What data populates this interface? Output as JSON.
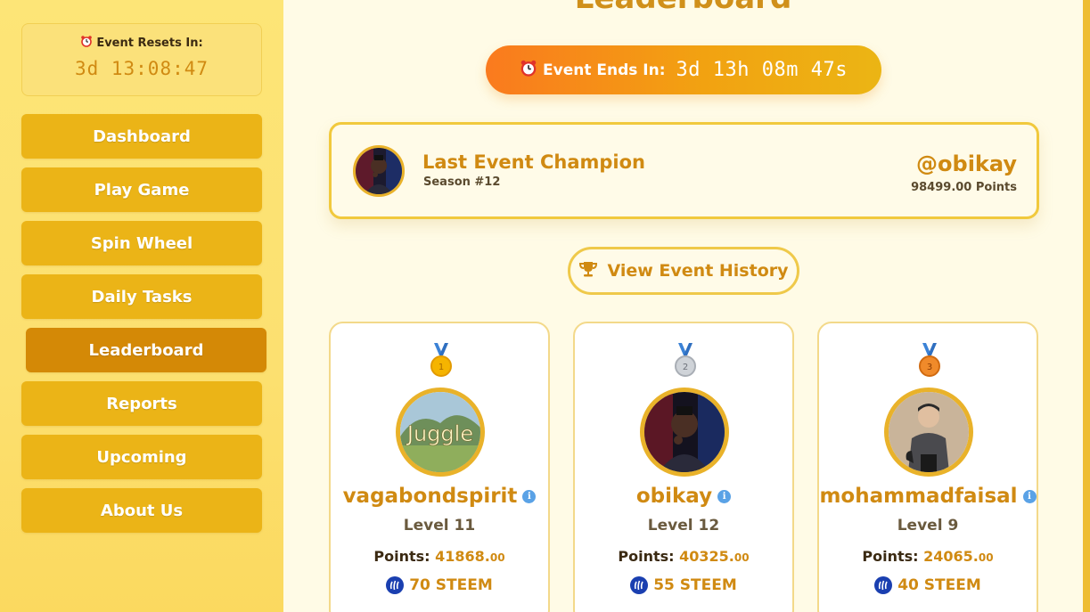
{
  "sidebar": {
    "reset_label": "Event Resets In:",
    "reset_time": "3d 13:08:47",
    "items": [
      {
        "label": "Dashboard",
        "active": false
      },
      {
        "label": "Play Game",
        "active": false
      },
      {
        "label": "Spin Wheel",
        "active": false
      },
      {
        "label": "Daily Tasks",
        "active": false
      },
      {
        "label": "Leaderboard",
        "active": true
      },
      {
        "label": "Reports",
        "active": false
      },
      {
        "label": "Upcoming",
        "active": false
      },
      {
        "label": "About Us",
        "active": false
      }
    ]
  },
  "main": {
    "title": "Leaderboard",
    "ends_label": "Event Ends In:",
    "ends_time": "3d 13h 08m 47s",
    "champion": {
      "title": "Last Event Champion",
      "season": "Season #12",
      "username": "@obikay",
      "points": "98499.00 Points"
    },
    "history_button": "View Event History",
    "points_label": "Points:",
    "top3": [
      {
        "rank": 1,
        "medal": "gold",
        "avatar_text": "Juggle",
        "username": "vagabondspirit",
        "level": "Level 11",
        "points": "41868.",
        "points_dec": "00",
        "reward": "70 STEEM"
      },
      {
        "rank": 2,
        "medal": "silver",
        "username": "obikay",
        "level": "Level 12",
        "points": "40325.",
        "points_dec": "00",
        "reward": "55 STEEM"
      },
      {
        "rank": 3,
        "medal": "bronze",
        "username": "mohammadfaisal",
        "level": "Level 9",
        "points": "24065.",
        "points_dec": "00",
        "reward": "40 STEEM"
      }
    ]
  },
  "colors": {
    "accent": "#d08a12",
    "nav_bg": "#ebb417",
    "nav_active": "#d48906",
    "sidebar_bg": "#fce070"
  }
}
